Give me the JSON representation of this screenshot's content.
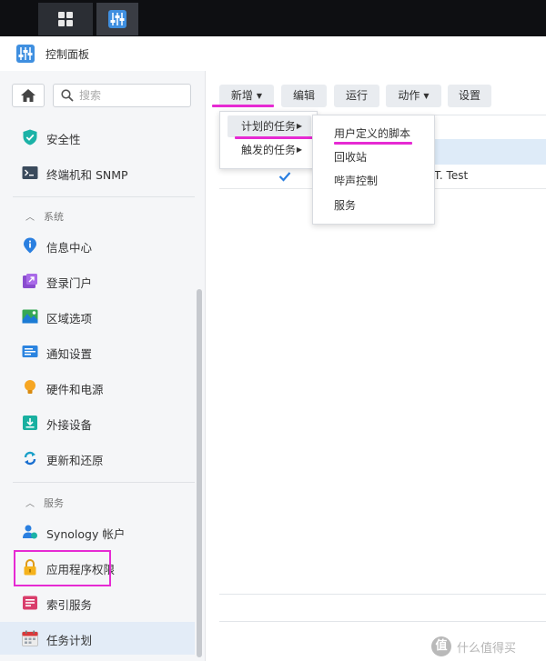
{
  "window": {
    "title": "控制面板"
  },
  "search": {
    "placeholder": "搜索"
  },
  "sidebar": {
    "top_items": [
      {
        "label": "安全性",
        "icon": "shield-icon"
      },
      {
        "label": "终端机和 SNMP",
        "icon": "terminal-icon"
      }
    ],
    "section_system": "系统",
    "system_items": [
      {
        "label": "信息中心",
        "icon": "info-icon"
      },
      {
        "label": "登录门户",
        "icon": "login-portal-icon"
      },
      {
        "label": "区域选项",
        "icon": "region-icon"
      },
      {
        "label": "通知设置",
        "icon": "notification-icon"
      },
      {
        "label": "硬件和电源",
        "icon": "bulb-icon"
      },
      {
        "label": "外接设备",
        "icon": "external-device-icon"
      },
      {
        "label": "更新和还原",
        "icon": "update-icon"
      }
    ],
    "section_services": "服务",
    "service_items": [
      {
        "label": "Synology 帐户",
        "icon": "account-icon"
      },
      {
        "label": "应用程序权限",
        "icon": "lock-icon"
      },
      {
        "label": "索引服务",
        "icon": "index-icon"
      },
      {
        "label": "任务计划",
        "icon": "calendar-icon"
      }
    ]
  },
  "toolbar": {
    "create": "新增",
    "edit": "编辑",
    "run": "运行",
    "action": "动作",
    "settings": "设置"
  },
  "menu_create": {
    "items": [
      "计划的任务",
      "触发的任务"
    ]
  },
  "menu_scheduled": {
    "items": [
      "用户定义的脚本",
      "回收站",
      "哔声控制",
      "服务"
    ]
  },
  "table": {
    "row_name": "T. Test"
  },
  "watermark": {
    "logo_char": "值",
    "text": "什么值得买"
  },
  "colors": {
    "highlight": "#e62ad3",
    "selected_row": "#deebf8"
  }
}
